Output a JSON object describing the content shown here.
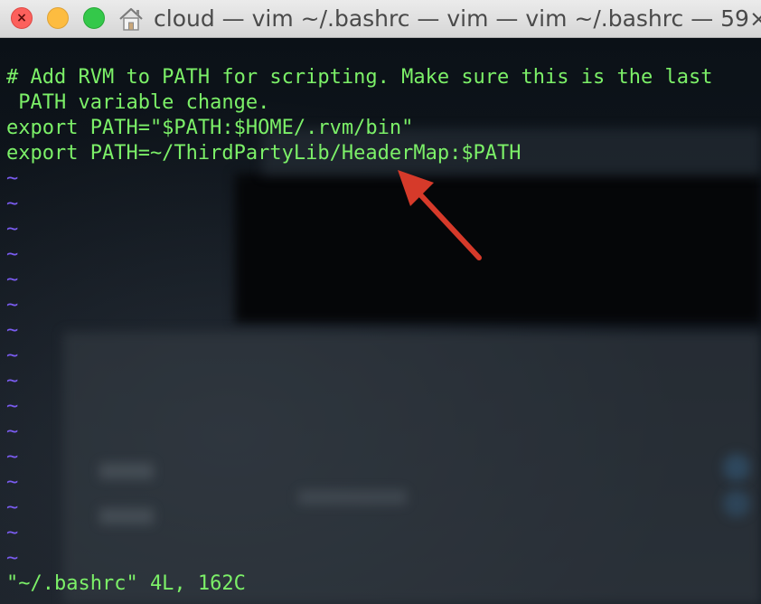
{
  "window": {
    "title": "cloud — vim ~/.bashrc — vim — vim ~/.bashrc — 59×…",
    "icon": "home-folder-icon"
  },
  "buffer": {
    "lines": [
      "# Add RVM to PATH for scripting. Make sure this is the last",
      " PATH variable change.",
      "export PATH=\"$PATH:$HOME/.rvm/bin\"",
      "export PATH=~/ThirdPartyLib/HeaderMap:$PATH"
    ],
    "empty_line_marker": "~",
    "empty_line_count": 16
  },
  "status": {
    "message": "\"~/.bashrc\" 4L, 162C"
  },
  "annotation": {
    "type": "arrow",
    "color": "#d63a2a",
    "points_to": "HeaderMap"
  },
  "colors": {
    "text": "#7cf068",
    "tilde": "#7a5cf0",
    "background": "#0b1117"
  }
}
